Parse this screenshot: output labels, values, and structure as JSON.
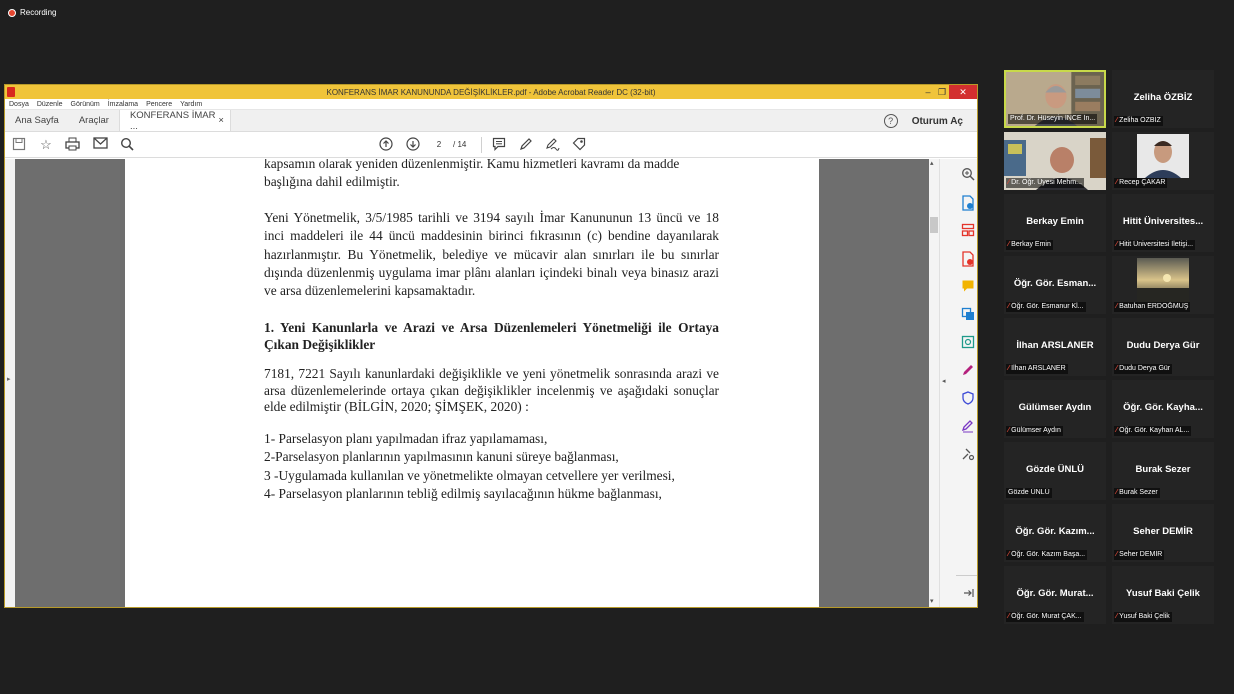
{
  "recording": {
    "label": "Recording"
  },
  "acrobat": {
    "window_title": "KONFERANS İMAR KANUNUNDA DEĞİŞİKLİKLER.pdf - Adobe Acrobat Reader DC (32-bit)",
    "menu": [
      "Dosya",
      "Düzenle",
      "Görünüm",
      "İmzalama",
      "Pencere",
      "Yardım"
    ],
    "tabs": {
      "home": "Ana Sayfa",
      "tools": "Araçlar",
      "document": "KONFERANS İMAR ...",
      "close": "×"
    },
    "help": "?",
    "signin": "Oturum Aç",
    "page_current": "2",
    "page_total": "/ 14",
    "document": {
      "para0_line1": "kapsamın olarak yeniden düzenlenmiştir. Kamu hizmetleri kavramı da madde",
      "para0_line2": "başlığına dahil edilmiştir.",
      "para1": "Yeni Yönetmelik, 3/5/1985 tarihli ve 3194 sayılı İmar Kanununun 13 üncü ve 18 inci maddeleri ile 44 üncü maddesinin birinci fıkrasının (c) bendine dayanılarak hazırlanmıştır. Bu Yönetmelik, belediye ve mücavir alan sınırları ile bu sınırlar dışında düzenlenmiş uygulama imar plânı alanları içindeki binalı veya binasız arazi ve arsa düzenlemelerini kapsamaktadır.",
      "heading": "1. Yeni Kanunlarla ve Arazi ve Arsa Düzenlemeleri Yönetmeliği ile Ortaya Çıkan Değişiklikler",
      "para2": "7181, 7221 Sayılı kanunlardaki değişiklikle ve yeni yönetmelik sonrasında arazi ve arsa düzenlemelerinde ortaya çıkan değişiklikler incelenmiş ve aşağıdaki sonuçlar elde edilmiştir (BİLGİN, 2020; ŞİMŞEK, 2020) :",
      "list": [
        "1- Parselasyon planı yapılmadan ifraz yapılamaması,",
        "2-Parselasyon planlarının  yapılmasının kanuni süreye bağlanması,",
        "3 -Uygulamada kullanılan ve  yönetmelikte olmayan cetvellere yer verilmesi,",
        "4- Parselasyon planlarının tebliğ edilmiş sayılacağının hükme bağlanması,"
      ]
    }
  },
  "participants": [
    {
      "name": "",
      "label": "Prof. Dr. Hüseyin İNCE İn...",
      "video": "man-bookshelf",
      "active": true,
      "muted": false
    },
    {
      "name": "Zeliha ÖZBİZ",
      "label": "Zeliha ÖZBİZ",
      "muted": true
    },
    {
      "name": "",
      "label": "Dr. Öğr. Üyesi Mehm...",
      "video": "man-office",
      "muted": true
    },
    {
      "name": "",
      "label": "Recep ÇAKAR",
      "video": "portrait",
      "muted": true
    },
    {
      "name": "Berkay Emin",
      "label": "Berkay Emin",
      "muted": true
    },
    {
      "name": "Hitit  Üniversites...",
      "label": "Hitit Üniversitesi İletişi...",
      "muted": true
    },
    {
      "name": "Öğr. Gör. Esman...",
      "label": "Öğr. Gör. Esmanur Kl...",
      "muted": true
    },
    {
      "name": "",
      "label": "Batuhan ERDOĞMUŞ",
      "video": "sunset",
      "muted": true
    },
    {
      "name": "İlhan ARSLANER",
      "label": "İlhan ARSLANER",
      "muted": true
    },
    {
      "name": "Dudu Derya Gür",
      "label": "Dudu Derya Gür",
      "muted": true
    },
    {
      "name": "Gülümser Aydın",
      "label": "Gülümser Aydın",
      "muted": true
    },
    {
      "name": "Öğr. Gör. Kayha...",
      "label": "Öğr. Gör. Kayhan AL...",
      "muted": true
    },
    {
      "name": "Gözde ÜNLÜ",
      "label": "Gözde ÜNLÜ",
      "muted": false
    },
    {
      "name": "Burak Sezer",
      "label": "Burak Sezer",
      "muted": true
    },
    {
      "name": "Öğr. Gör. Kazım...",
      "label": "Öğr. Gör. Kazım Başa...",
      "muted": true
    },
    {
      "name": "Seher DEMİR",
      "label": "Seher DEMİR",
      "muted": true
    },
    {
      "name": "Öğr. Gör. Murat...",
      "label": "Öğr. Gör. Murat ÇAK...",
      "muted": true
    },
    {
      "name": "Yusuf Baki Çelik",
      "label": "Yusuf Baki Çelik",
      "muted": true
    }
  ],
  "icons": {
    "toolbar": [
      "save-icon",
      "star-icon",
      "print-icon",
      "email-icon",
      "search-icon",
      "prev-page-icon",
      "next-page-icon",
      "comment-icon",
      "pen-icon",
      "sign-icon",
      "share-icon"
    ],
    "right_panel": [
      "zoom-icon",
      "export-pdf-icon",
      "organize-pages-icon",
      "create-pdf-icon",
      "comment-icon",
      "combine-icon",
      "scan-icon",
      "fill-sign-icon",
      "protect-icon",
      "edit-icon",
      "more-tools-icon",
      "collapse-panel-icon"
    ]
  },
  "colors": {
    "accent": "#f0c43a",
    "mic_muted": "#e04a3a",
    "active_speaker": "#c8d94a",
    "pdf_red": "#d8281e"
  }
}
